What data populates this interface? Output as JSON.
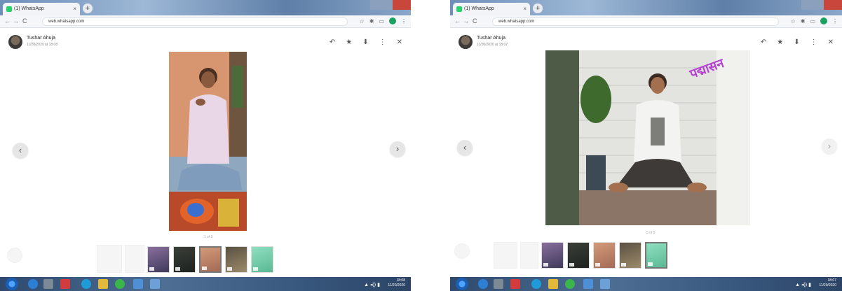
{
  "left": {
    "tab": {
      "title": "(1) WhatsApp",
      "close": "×"
    },
    "newtab": "+",
    "address": "web.whatsapp.com",
    "nav": {
      "back": "←",
      "forward": "→",
      "reload": "C"
    },
    "sender": {
      "name": "Tushar Ahuja",
      "time": "11/20/2020 at 18:08"
    },
    "header_icons": {
      "reply": "↶",
      "star": "★",
      "download": "⬇",
      "menu": "⋮",
      "close": "✕"
    },
    "caption": "1 of 5",
    "arrow_prev": "‹",
    "arrow_next": "›",
    "tray": {
      "icons": "▲ ◂)) ▮",
      "time": "18:08",
      "date": "11/20/2020"
    }
  },
  "right": {
    "tab": {
      "title": "(1) WhatsApp",
      "close": "×"
    },
    "newtab": "+",
    "address": "web.whatsapp.com",
    "nav": {
      "back": "←",
      "forward": "→",
      "reload": "C"
    },
    "sender": {
      "name": "Tushar Ahuja",
      "time": "11/20/2020 at 18:07"
    },
    "header_icons": {
      "reply": "↶",
      "star": "★",
      "download": "⬇",
      "menu": "⋮",
      "close": "✕"
    },
    "overlay_text": "पद्मासन",
    "caption": "5 of 5",
    "arrow_prev": "‹",
    "arrow_next": "›",
    "tray": {
      "icons": "▲ ◂)) ▮",
      "time": "18:07",
      "date": "11/20/2020"
    }
  },
  "colors": {
    "whatsapp_green": "#25d366",
    "taskbar": "#2f4a6e",
    "mint_thumb": "#7fd3b0"
  }
}
